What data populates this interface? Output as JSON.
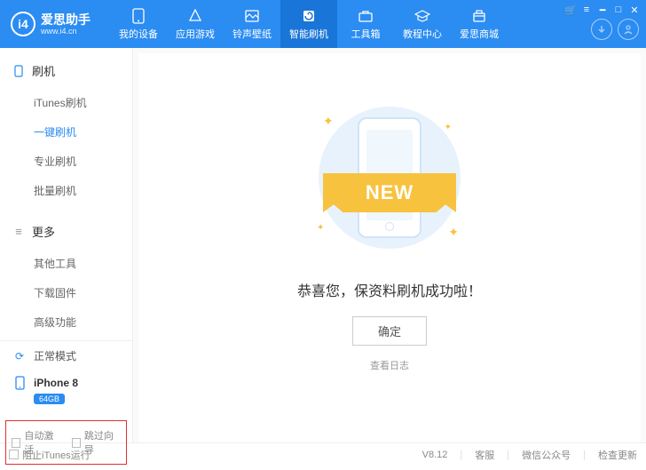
{
  "header": {
    "logo_badge": "i4",
    "logo_cn": "爱思助手",
    "logo_url": "www.i4.cn",
    "nav": [
      {
        "label": "我的设备"
      },
      {
        "label": "应用游戏"
      },
      {
        "label": "铃声壁纸"
      },
      {
        "label": "智能刷机",
        "active": true
      },
      {
        "label": "工具箱"
      },
      {
        "label": "教程中心"
      },
      {
        "label": "爱思商城"
      }
    ]
  },
  "sidebar": {
    "sections": [
      {
        "title": "刷机",
        "items": [
          {
            "label": "iTunes刷机"
          },
          {
            "label": "一键刷机",
            "active": true
          },
          {
            "label": "专业刷机"
          },
          {
            "label": "批量刷机"
          }
        ]
      },
      {
        "title": "更多",
        "items": [
          {
            "label": "其他工具"
          },
          {
            "label": "下载固件"
          },
          {
            "label": "高级功能"
          }
        ]
      }
    ],
    "status_mode": "正常模式",
    "device_name": "iPhone 8",
    "device_storage": "64GB",
    "checkboxes": {
      "auto_activate": "自动激活",
      "skip_guide": "跳过向导"
    }
  },
  "main": {
    "ribbon": "NEW",
    "success_text": "恭喜您，保资料刷机成功啦！",
    "confirm": "确定",
    "view_log": "查看日志"
  },
  "footer": {
    "block_itunes": "阻止iTunes运行",
    "version": "V8.12",
    "support": "客服",
    "wechat": "微信公众号",
    "update": "检查更新"
  }
}
